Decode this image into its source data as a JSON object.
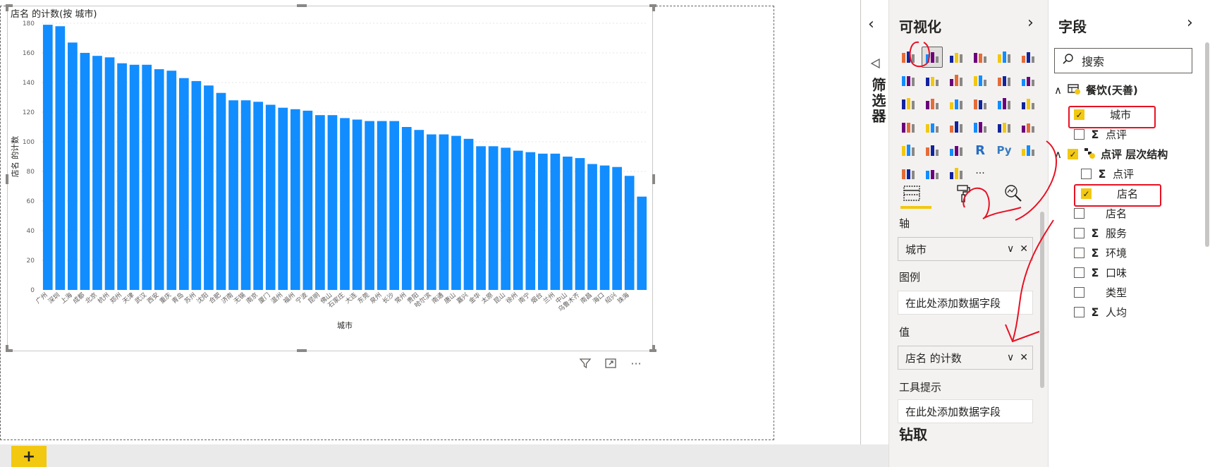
{
  "chart_data": {
    "type": "bar",
    "title": "店名 的计数(按 城市)",
    "xlabel": "城市",
    "ylabel": "店名 的计数",
    "ylim": [
      0,
      180
    ],
    "yticks": [
      0,
      20,
      40,
      60,
      80,
      100,
      120,
      140,
      160,
      180
    ],
    "grid": true,
    "categories": [
      "广州",
      "深圳",
      "上海",
      "成都",
      "北京",
      "杭州",
      "郑州",
      "天津",
      "武汉",
      "西安",
      "重庆",
      "青岛",
      "苏州",
      "沈阳",
      "合肥",
      "济南",
      "无锡",
      "南京",
      "厦门",
      "温州",
      "福州",
      "宁波",
      "昆明",
      "佛山",
      "石家庄",
      "大连",
      "东莞",
      "泉州",
      "长沙",
      "常州",
      "贵阳",
      "哈尔滨",
      "南通",
      "唐山",
      "嘉兴",
      "金华",
      "太原",
      "昆山",
      "徐州",
      "南宁",
      "烟台",
      "兰州",
      "中山",
      "乌鲁木齐",
      "南昌",
      "海口",
      "绍兴",
      "珠海"
    ],
    "values": [
      179,
      178,
      167,
      160,
      158,
      157,
      153,
      152,
      152,
      149,
      148,
      143,
      141,
      138,
      133,
      128,
      128,
      127,
      125,
      123,
      122,
      121,
      118,
      118,
      116,
      115,
      114,
      114,
      114,
      110,
      108,
      105,
      105,
      104,
      102,
      97,
      97,
      96,
      94,
      93,
      92,
      92,
      90,
      89,
      85,
      84,
      83,
      77,
      63
    ],
    "bar_color": "#118dff"
  },
  "visual_footer": {
    "filter_icon": "funnel-icon",
    "focus_icon": "focus-mode-icon",
    "more_label": "···"
  },
  "bottom": {
    "add_page_label": "+"
  },
  "filter_pane": {
    "collapse_label": "‹",
    "label": "筛选器"
  },
  "viz_pane": {
    "title": "可视化",
    "next_label": "›",
    "icon_count": 34,
    "selected_index": 1,
    "more_label": "···",
    "r_label": "R",
    "py_label": "Py",
    "sections": {
      "axis_label": "轴",
      "axis_value": "城市",
      "legend_label": "图例",
      "legend_placeholder": "在此处添加数据字段",
      "values_label": "值",
      "values_value": "店名 的计数",
      "tooltip_label": "工具提示",
      "tooltip_placeholder": "在此处添加数据字段",
      "drill_label": "钻取"
    },
    "well_controls": {
      "expand": "∨",
      "remove": "✕"
    }
  },
  "fields_pane": {
    "title": "字段",
    "next_label": "›",
    "search_placeholder": "搜索",
    "rows": [
      {
        "kind": "table",
        "label": "餐饮(天善)",
        "expand": "∧"
      },
      {
        "kind": "field",
        "label": "城市",
        "checked": true,
        "sigma": false
      },
      {
        "kind": "field",
        "label": "点评",
        "checked": false,
        "sigma": true
      },
      {
        "kind": "hierarchy",
        "label": "点评 层次结构",
        "checked": true,
        "expand": "∧"
      },
      {
        "kind": "field",
        "label": "点评",
        "checked": false,
        "sigma": true
      },
      {
        "kind": "field",
        "label": "店名",
        "checked": true,
        "sigma": false
      },
      {
        "kind": "field",
        "label": "店名",
        "checked": false,
        "sigma": false
      },
      {
        "kind": "field",
        "label": "服务",
        "checked": false,
        "sigma": true
      },
      {
        "kind": "field",
        "label": "环境",
        "checked": false,
        "sigma": true
      },
      {
        "kind": "field",
        "label": "口味",
        "checked": false,
        "sigma": true
      },
      {
        "kind": "field",
        "label": "类型",
        "checked": false,
        "sigma": false
      },
      {
        "kind": "field",
        "label": "人均",
        "checked": false,
        "sigma": true
      }
    ],
    "sigma_symbol": "Σ",
    "check_symbol": "✓"
  },
  "colors": {
    "accent": "#f2c811",
    "bar": "#118dff",
    "annotation": "#e81123"
  }
}
